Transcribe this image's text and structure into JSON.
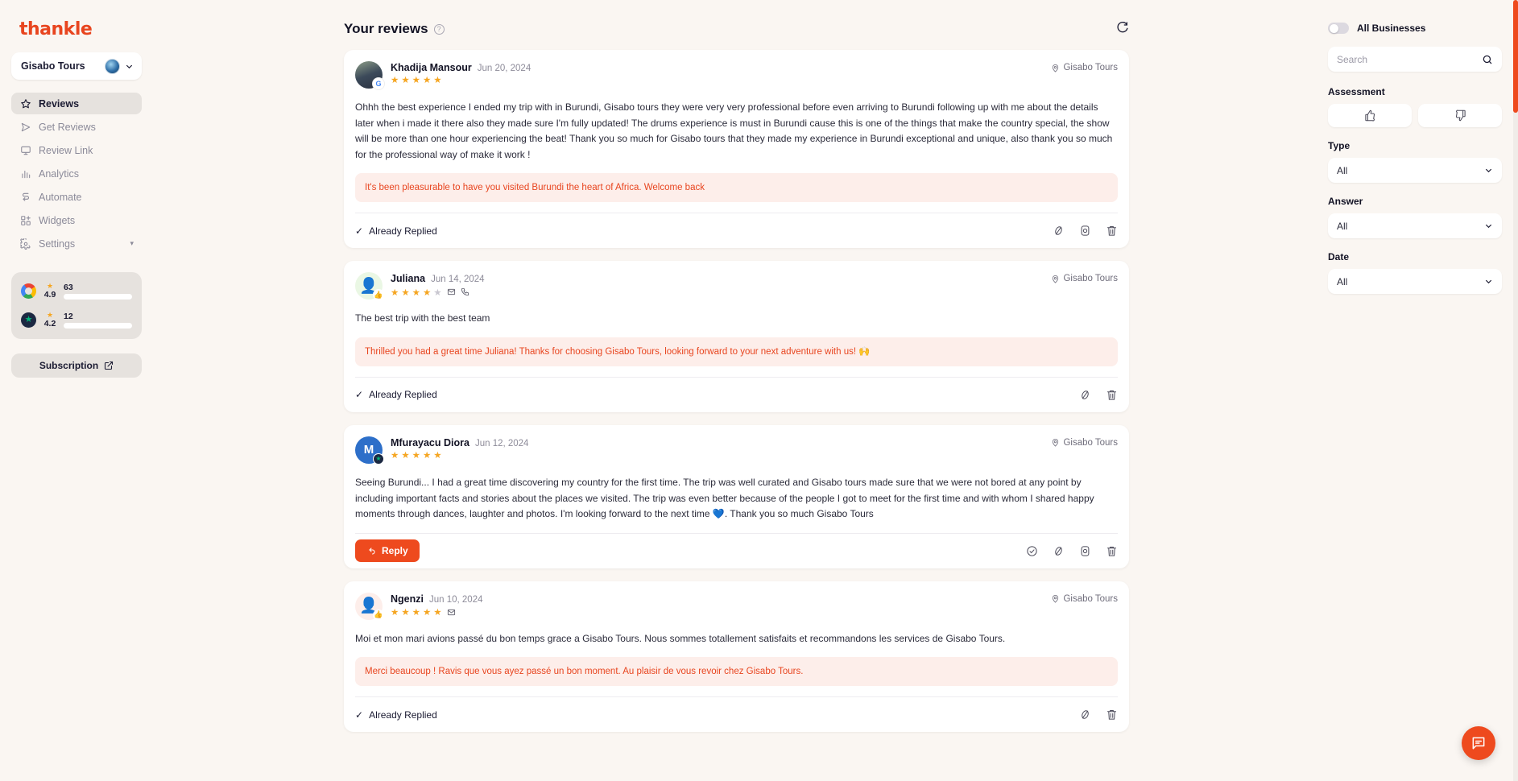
{
  "brand": {
    "logo_text": "thankle",
    "accent": "#ee4a1e",
    "dark": "#1b1b32"
  },
  "sidebar": {
    "business_name": "Gisabo Tours",
    "items": [
      {
        "label": "Reviews",
        "icon": "star-icon",
        "active": true
      },
      {
        "label": "Get Reviews",
        "icon": "send-icon",
        "active": false
      },
      {
        "label": "Review Link",
        "icon": "monitor-icon",
        "active": false
      },
      {
        "label": "Analytics",
        "icon": "bar-chart-icon",
        "active": false
      },
      {
        "label": "Automate",
        "icon": "automate-icon",
        "active": false
      },
      {
        "label": "Widgets",
        "icon": "widgets-icon",
        "active": false
      },
      {
        "label": "Settings",
        "icon": "gear-icon",
        "active": false
      }
    ],
    "stats": [
      {
        "source": "Google",
        "rating": "4.9",
        "count": "63",
        "percent": 88
      },
      {
        "source": "Trustpilot",
        "rating": "4.2",
        "count": "12",
        "percent": 17
      }
    ],
    "subscription_label": "Subscription"
  },
  "main": {
    "title": "Your reviews",
    "help_icon": "help-circle-icon",
    "refresh_icon": "refresh-icon",
    "reviews": [
      {
        "name": "Khadija Mansour",
        "date": "Jun 20, 2024",
        "location": "Gisabo Tours",
        "stars": 5,
        "source_badge": "google",
        "avatar_type": "photo",
        "avatar_initial": "",
        "contact_icons": [],
        "body": "Ohhh the best experience I ended my trip with in Burundi, Gisabo tours they were very very professional before even arriving to Burundi following up with me about the details later when i made it there also they made sure I'm fully updated! The drums experience is must in Burundi cause this is one of the things that make the country special, the show will be more than one hour experiencing the beat! Thank you so much for Gisabo tours that they made my experience in Burundi exceptional and unique, also thank you so much for the professional way of make it work !",
        "reply": "It's been pleasurable to have you visited Burundi the heart of Africa. Welcome back",
        "status_label": "Already Replied",
        "has_reply_button": false,
        "actions": [
          "hide-icon",
          "instagram-icon",
          "trash-icon"
        ]
      },
      {
        "name": "Juliana",
        "date": "Jun 14, 2024",
        "location": "Gisabo Tours",
        "stars": 4,
        "source_badge": "thumb",
        "avatar_type": "green",
        "avatar_initial": "",
        "contact_icons": [
          "email-icon",
          "phone-icon"
        ],
        "body": "The best trip with the best team",
        "reply": "Thrilled you had a great time Juliana! Thanks for choosing Gisabo Tours, looking forward to your next adventure with us! 🙌",
        "status_label": "Already Replied",
        "has_reply_button": false,
        "actions": [
          "hide-icon",
          "trash-icon"
        ]
      },
      {
        "name": "Mfurayacu Diora",
        "date": "Jun 12, 2024",
        "location": "Gisabo Tours",
        "stars": 5,
        "source_badge": "trustpilot",
        "avatar_type": "blue",
        "avatar_initial": "M",
        "contact_icons": [],
        "body": "Seeing Burundi... I had a great time discovering my country for the first time. The trip was well curated and Gisabo tours made sure that we were not bored at any point by including important facts and stories about the places we visited. The trip was even better because of the people I got to meet for the first time and with whom I shared happy moments through dances, laughter and photos. I'm looking forward to the next time 💙. Thank you so much Gisabo Tours",
        "reply": "",
        "status_label": "",
        "has_reply_button": true,
        "reply_button_label": "Reply",
        "actions": [
          "check-circle-icon",
          "hide-icon",
          "instagram-icon",
          "trash-icon"
        ]
      },
      {
        "name": "Ngenzi",
        "date": "Jun 10, 2024",
        "location": "Gisabo Tours",
        "stars": 5,
        "source_badge": "thumb",
        "avatar_type": "pink",
        "avatar_initial": "",
        "contact_icons": [
          "email-icon"
        ],
        "body": "Moi et mon mari avions passé du bon temps grace a Gisabo Tours. Nous sommes totallement satisfaits et recommandons les services de Gisabo Tours.",
        "reply": "Merci beaucoup ! Ravis que vous ayez passé un bon moment. Au plaisir de vous revoir chez Gisabo Tours.",
        "status_label": "Already Replied",
        "has_reply_button": false,
        "actions": [
          "hide-icon",
          "trash-icon"
        ]
      }
    ]
  },
  "filters": {
    "all_businesses_label": "All Businesses",
    "all_businesses_on": false,
    "search_placeholder": "Search",
    "search_value": "",
    "assessment_label": "Assessment",
    "thumbs_up_icon": "thumbs-up-icon",
    "thumbs_down_icon": "thumbs-down-icon",
    "type_label": "Type",
    "type_value": "All",
    "answer_label": "Answer",
    "answer_value": "All",
    "date_label": "Date",
    "date_value": "All"
  },
  "chat": {
    "icon": "chat-bubble-icon"
  }
}
